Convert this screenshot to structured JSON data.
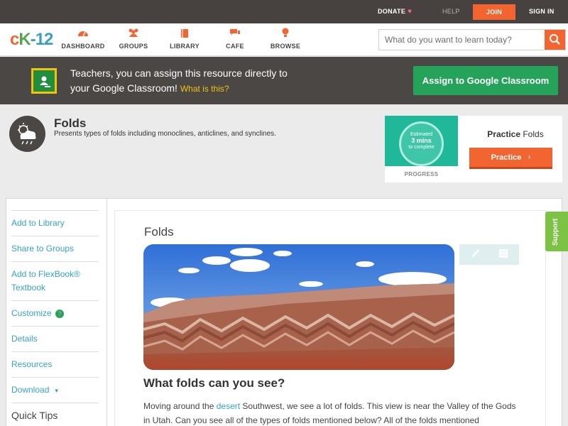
{
  "topbar": {
    "donate": "DONATE",
    "help": "HELP",
    "join": "JOIN",
    "signin": "SIGN IN"
  },
  "nav": {
    "logo": [
      "c",
      "K",
      "-12"
    ],
    "items": [
      {
        "label": "DASHBOARD",
        "icon": "dashboard-icon"
      },
      {
        "label": "GROUPS",
        "icon": "groups-icon"
      },
      {
        "label": "LIBRARY",
        "icon": "library-icon"
      },
      {
        "label": "CAFE",
        "icon": "cafe-icon"
      },
      {
        "label": "BROWSE",
        "icon": "browse-icon"
      }
    ],
    "search_placeholder": "What do you want to learn today?"
  },
  "banner": {
    "line1": "Teachers, you can assign this resource directly to",
    "line2": "your Google Classroom!",
    "what": "What is this?",
    "assign": "Assign to Google Classroom"
  },
  "concept": {
    "title": "Folds",
    "description": "Presents types of folds including monoclines, anticlines, and synclines.",
    "icon": "weather-cloud-icon"
  },
  "practice": {
    "estimated": "Estimated",
    "mins": "3 mins",
    "to_complete": "to complete",
    "progress": "PROGRESS",
    "title_bold": "Practice",
    "title_rest": "Folds",
    "button": "Practice"
  },
  "sidebar": {
    "items": [
      "Add to Library",
      "Share to Groups",
      "Add to FlexBook®",
      "Textbook",
      "Customize",
      "Details",
      "Resources",
      "Download",
      "Quick Tips"
    ]
  },
  "content": {
    "title": "Folds",
    "heading": "What folds can you see?",
    "p_start": "Moving around the ",
    "p_link": "desert",
    "p_rest": " Southwest, we see a lot of folds. This view is near the Valley of the Gods in Utah. Can you see all of the types of folds mentioned below? All of the folds mentioned"
  },
  "support": "Support",
  "colors": {
    "accent": "#f26430",
    "green": "#25a35a",
    "link": "#37a1c8",
    "dark": "#474240"
  }
}
